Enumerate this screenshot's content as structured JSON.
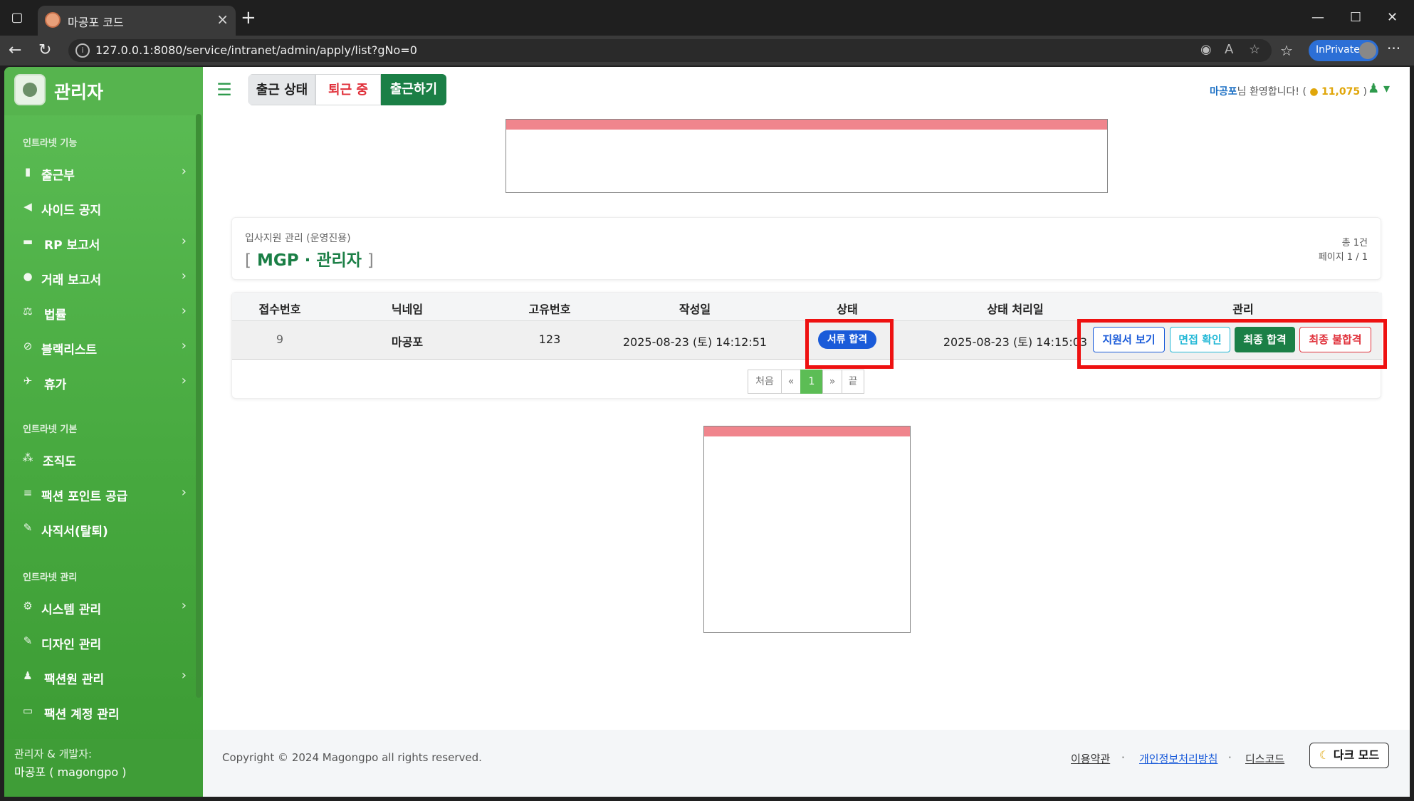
{
  "browser": {
    "tab_title": "마공포 코드",
    "url": "127.0.0.1:8080/service/intranet/admin/apply/list?gNo=0",
    "inprivate_label": "InPrivate"
  },
  "sidebar": {
    "brand": "관리자",
    "sections": [
      {
        "title": "인트라넷 기능",
        "items": [
          {
            "label": "출근부",
            "icon": "book-icon",
            "chevron": true
          },
          {
            "label": "사이드 공지",
            "icon": "megaphone-icon",
            "chevron": false
          },
          {
            "label": "RP 보고서",
            "icon": "gamepad-icon",
            "chevron": true
          },
          {
            "label": "거래 보고서",
            "icon": "money-bag-icon",
            "chevron": true
          },
          {
            "label": "법률",
            "icon": "scale-icon",
            "chevron": true
          },
          {
            "label": "블랙리스트",
            "icon": "ban-icon",
            "chevron": true
          },
          {
            "label": "휴가",
            "icon": "plane-icon",
            "chevron": true
          }
        ]
      },
      {
        "title": "인트라넷 기본",
        "items": [
          {
            "label": "조직도",
            "icon": "sitemap-icon",
            "chevron": false
          },
          {
            "label": "팩션 포인트 공급",
            "icon": "coins-icon",
            "chevron": true
          },
          {
            "label": "사직서(탈퇴)",
            "icon": "feather-icon",
            "chevron": false
          }
        ]
      },
      {
        "title": "인트라넷 관리",
        "items": [
          {
            "label": "시스템 관리",
            "icon": "gear-icon",
            "chevron": true
          },
          {
            "label": "디자인 관리",
            "icon": "brush-icon",
            "chevron": false
          },
          {
            "label": "팩션원 관리",
            "icon": "user-gear-icon",
            "chevron": true
          },
          {
            "label": "팩션 계정 관리",
            "icon": "id-card-icon",
            "chevron": false
          }
        ]
      }
    ],
    "footer_line1": "관리자 & 개발자:",
    "footer_line2": "마공포 ( magongpo )"
  },
  "topnav": {
    "status_label": "출근 상태",
    "status_value": "퇴근 중",
    "checkin_button": "출근하기",
    "welcome_name": "마공포",
    "welcome_text": "님 환영합니다! (",
    "points": "11,075",
    "welcome_close": ")"
  },
  "header_card": {
    "subtitle": "입사지원 관리 (운영진용)",
    "title_open": "[",
    "title": "MGP · 관리자",
    "title_close": "]",
    "total_label": "총 1건",
    "page_label": "페이지 1 / 1"
  },
  "table": {
    "columns": [
      "접수번호",
      "닉네임",
      "고유번호",
      "작성일",
      "상태",
      "상태 처리일",
      "관리"
    ],
    "rows": [
      {
        "no": "9",
        "nickname": "마공포",
        "uid": "123",
        "created": "2025-08-23 (토) 14:12:51",
        "status": "서류 합격",
        "processed": "2025-08-23 (토) 14:15:03"
      }
    ],
    "actions": [
      "지원서 보기",
      "면접 확인",
      "최종 합격",
      "최종 불합격"
    ]
  },
  "pagination": {
    "first": "처음",
    "prev": "«",
    "current": "1",
    "next": "»",
    "last": "끝"
  },
  "footer": {
    "copyright": "Copyright © 2024 Magongpo all rights reserved.",
    "links": [
      "이용약관",
      "개인정보처리방침",
      "디스코드"
    ],
    "dark_mode": "다크 모드"
  },
  "colors": {
    "accent": "#1b7f46",
    "sidebar": "#4caf45",
    "status_badge": "#1a5bd9",
    "highlight": "#ee1111"
  }
}
